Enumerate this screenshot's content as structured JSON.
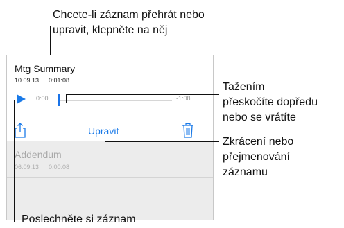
{
  "callouts": {
    "top_line1": "Chcete-li záznam přehrát nebo",
    "top_line2": "upravit, klepněte na něj",
    "scrub_line1": "Tažením",
    "scrub_line2": "přeskočíte dopředu",
    "scrub_line3": "nebo se vrátíte",
    "edit_line1": "Zkrácení nebo",
    "edit_line2": "přejmenování",
    "edit_line3": "záznamu",
    "bottom": "Poslechněte si záznam"
  },
  "recordings": [
    {
      "title": "Mtg Summary",
      "date": "10.09.13",
      "duration": "0:01:08",
      "elapsed": "0:00",
      "remaining": "-1:08",
      "progress": 0
    },
    {
      "title": "Addendum",
      "date": "06.09.13",
      "duration": "0:00:08"
    }
  ],
  "toolbar": {
    "edit_label": "Upravit",
    "share_icon": "share-icon",
    "trash_icon": "trash-icon",
    "play_icon": "play-icon"
  },
  "colors": {
    "accent": "#1a7ae8",
    "inactive_row": "#ececec"
  }
}
